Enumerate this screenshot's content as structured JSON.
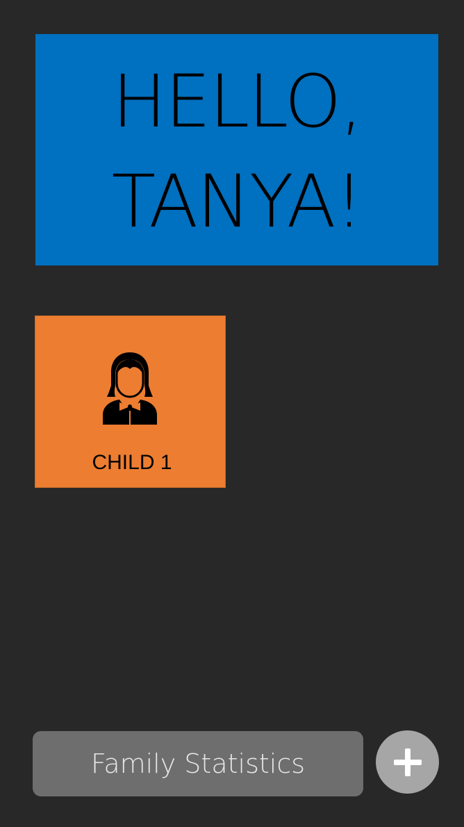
{
  "greeting": {
    "text": "HELLO,\nTANYA!",
    "background_color": "#0070C0"
  },
  "children": [
    {
      "label": "CHILD 1",
      "icon": "girl-avatar-icon",
      "card_color": "#ED7D31"
    }
  ],
  "footer": {
    "stats_label": "Family Statistics",
    "add_icon": "plus-icon"
  }
}
